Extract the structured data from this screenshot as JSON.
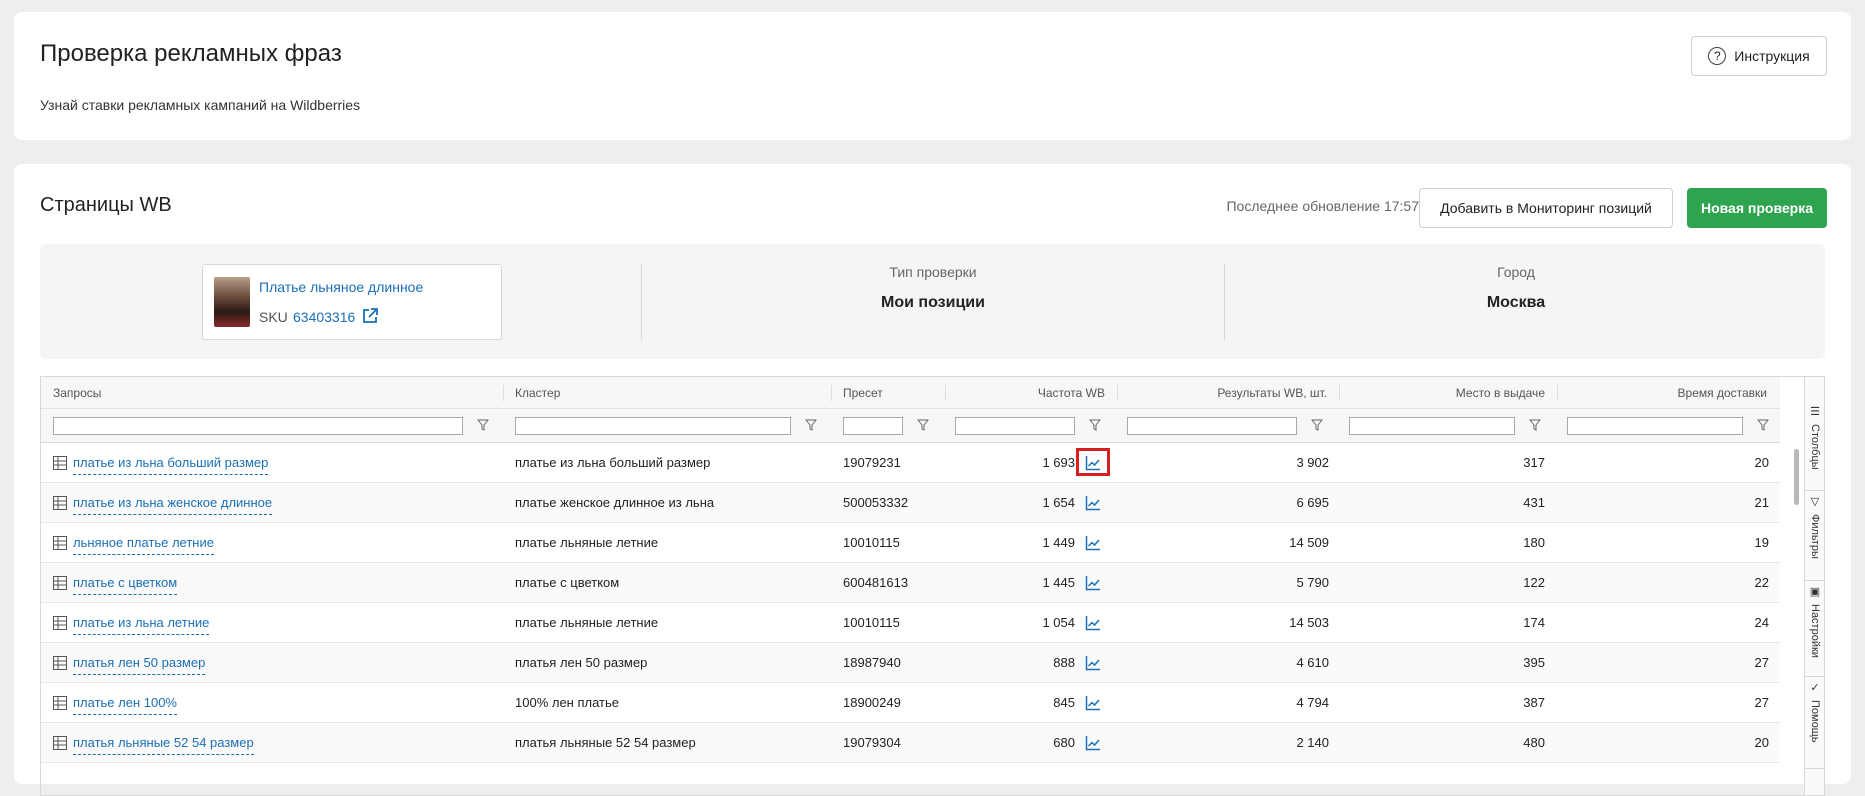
{
  "header": {
    "title": "Проверка рекламных фраз",
    "subtitle": "Узнай ставки рекламных кампаний на Wildberries",
    "instruction_label": "Инструкция",
    "instruction_icon": "question-circle-icon"
  },
  "section": {
    "title": "Страницы WB",
    "last_update": "Последнее обновление 17:57",
    "monitor_button": "Добавить в Мониторинг позиций",
    "new_check_button": "Новая проверка",
    "accent_green": "#2ea44f"
  },
  "product": {
    "name": "Платье льняное длинное",
    "sku_label": "SKU",
    "sku": "63403316",
    "link_icon": "external-link-icon"
  },
  "info": {
    "check_type_label": "Тип проверки",
    "check_type_value": "Мои позиции",
    "city_label": "Город",
    "city_value": "Москва"
  },
  "table": {
    "columns": [
      "Запросы",
      "Кластер",
      "Пресет",
      "Частота WB",
      "Результаты WB, шт.",
      "Место в выдаче",
      "Время доставки"
    ],
    "rows": [
      {
        "query": "платье из льна больший размер",
        "cluster": "платье из льна больший размер",
        "preset": "19079231",
        "freq": "1 693",
        "results": "3 902",
        "place": "317",
        "delivery": "20"
      },
      {
        "query": "платье из льна женское длинное",
        "cluster": "платье женское длинное из льна",
        "preset": "500053332",
        "freq": "1 654",
        "results": "6 695",
        "place": "431",
        "delivery": "21"
      },
      {
        "query": "льняное платье летние",
        "cluster": "платье льняные летние",
        "preset": "10010115",
        "freq": "1 449",
        "results": "14 509",
        "place": "180",
        "delivery": "19"
      },
      {
        "query": "платье с цветком",
        "cluster": "платье с цветком",
        "preset": "600481613",
        "freq": "1 445",
        "results": "5 790",
        "place": "122",
        "delivery": "22"
      },
      {
        "query": "платье из льна летние",
        "cluster": "платье льняные летние",
        "preset": "10010115",
        "freq": "1 054",
        "results": "14 503",
        "place": "174",
        "delivery": "24"
      },
      {
        "query": "платья лен 50 размер",
        "cluster": "платья лен 50 размер",
        "preset": "18987940",
        "freq": "888",
        "results": "4 610",
        "place": "395",
        "delivery": "27"
      },
      {
        "query": "платье лен 100%",
        "cluster": "100% лен платье",
        "preset": "18900249",
        "freq": "845",
        "results": "4 794",
        "place": "387",
        "delivery": "27"
      },
      {
        "query": "платья льняные 52 54 размер",
        "cluster": "платья льняные 52 54 размер",
        "preset": "19079304",
        "freq": "680",
        "results": "2 140",
        "place": "480",
        "delivery": "20"
      }
    ],
    "highlight_color": "#d61f1f"
  },
  "side_tabs": [
    "Столбцы",
    "Фильтры",
    "Настройки",
    "Помощь"
  ]
}
